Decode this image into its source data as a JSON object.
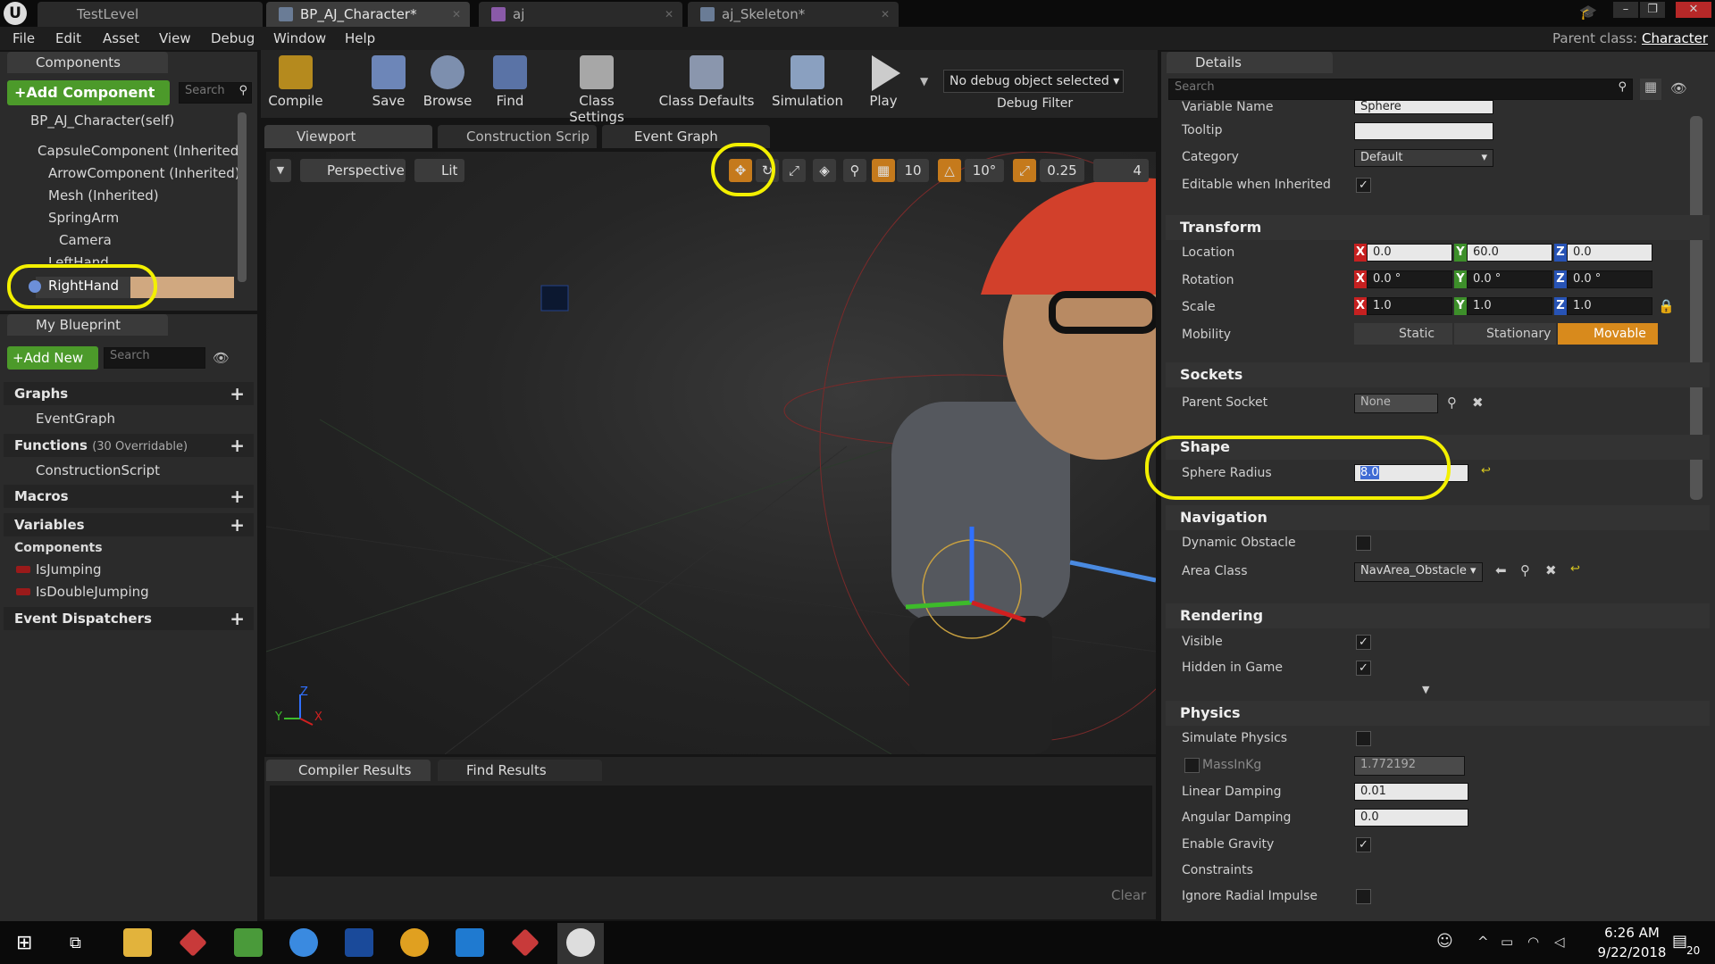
{
  "tabs": [
    "TestLevel",
    "BP_AJ_Character*",
    "aj",
    "aj_Skeleton*"
  ],
  "menu": [
    "File",
    "Edit",
    "Asset",
    "View",
    "Debug",
    "Window",
    "Help"
  ],
  "parent_class": {
    "label": "Parent class:",
    "value": "Character"
  },
  "components_panel": {
    "title": "Components",
    "add_button": "+Add Component",
    "search_placeholder": "Search",
    "self": "BP_AJ_Character(self)",
    "items": [
      "CapsuleComponent (Inherited)",
      "ArrowComponent (Inherited)",
      "Mesh (Inherited)",
      "SpringArm",
      "Camera",
      "LeftHand",
      "RightHand"
    ]
  },
  "blueprint_panel": {
    "title": "My Blueprint",
    "add_new": "+Add New",
    "search_placeholder": "Search",
    "graphs": "Graphs",
    "event_graph": "EventGraph",
    "functions": "Functions",
    "functions_count": "(30 Overridable)",
    "construction_script": "ConstructionScript",
    "macros": "Macros",
    "variables": "Variables",
    "components": "Components",
    "var_items": [
      "IsJumping",
      "IsDoubleJumping"
    ],
    "dispatchers": "Event Dispatchers"
  },
  "toolbar": {
    "buttons": [
      "Compile",
      "Save",
      "Browse",
      "Find",
      "Class Settings",
      "Class Defaults",
      "Simulation",
      "Play"
    ],
    "debug_select": "No debug object selected",
    "debug_filter": "Debug Filter"
  },
  "editor_tabs": [
    "Viewport",
    "Construction Scrip",
    "Event Graph"
  ],
  "viewport": {
    "perspective": "Perspective",
    "lit": "Lit",
    "grid_snap": "10",
    "rot_snap": "10°",
    "scale_snap": "0.25",
    "cam_speed": "4",
    "axis_labels": [
      "Y",
      "X",
      "Z"
    ]
  },
  "bottom_tabs": [
    "Compiler Results",
    "Find Results"
  ],
  "clear_label": "Clear",
  "details": {
    "title": "Details",
    "search_placeholder": "Search",
    "rows": {
      "variable_name": {
        "label": "Variable Name",
        "value": "Sphere"
      },
      "tooltip": {
        "label": "Tooltip",
        "value": ""
      },
      "category": {
        "label": "Category",
        "value": "Default"
      },
      "editable": {
        "label": "Editable when Inherited"
      }
    },
    "transform": {
      "title": "Transform",
      "location": {
        "label": "Location",
        "x": "0.0",
        "y": "60.0",
        "z": "0.0"
      },
      "rotation": {
        "label": "Rotation",
        "x": "0.0 °",
        "y": "0.0 °",
        "z": "0.0 °"
      },
      "scale": {
        "label": "Scale",
        "x": "1.0",
        "y": "1.0",
        "z": "1.0"
      },
      "mobility": {
        "label": "Mobility",
        "options": [
          "Static",
          "Stationary",
          "Movable"
        ],
        "selected": "Movable"
      }
    },
    "sockets": {
      "title": "Sockets",
      "parent_socket": {
        "label": "Parent Socket",
        "value": "None"
      }
    },
    "shape": {
      "title": "Shape",
      "sphere_radius": {
        "label": "Sphere Radius",
        "value": "8.0"
      }
    },
    "navigation": {
      "title": "Navigation",
      "dynamic_obstacle": "Dynamic Obstacle",
      "area_class": {
        "label": "Area Class",
        "value": "NavArea_Obstacle"
      }
    },
    "rendering": {
      "title": "Rendering",
      "visible": "Visible",
      "hidden_in_game": "Hidden in Game"
    },
    "physics": {
      "title": "Physics",
      "simulate": "Simulate Physics",
      "mass": {
        "label": "MassInKg",
        "value": "1.772192"
      },
      "linear_damping": {
        "label": "Linear Damping",
        "value": "0.01"
      },
      "angular_damping": {
        "label": "Angular Damping",
        "value": "0.0"
      },
      "gravity": "Enable Gravity",
      "constraints": "Constraints",
      "radial": "Ignore Radial Impulse"
    }
  },
  "clock": {
    "time": "6:26 AM",
    "date": "9/22/2018"
  },
  "notify_count": "20",
  "colors": {
    "accent": "#f3f000",
    "movable": "#d88a1c",
    "x": "#c62020",
    "y": "#3d8f2a",
    "z": "#2753b5"
  }
}
